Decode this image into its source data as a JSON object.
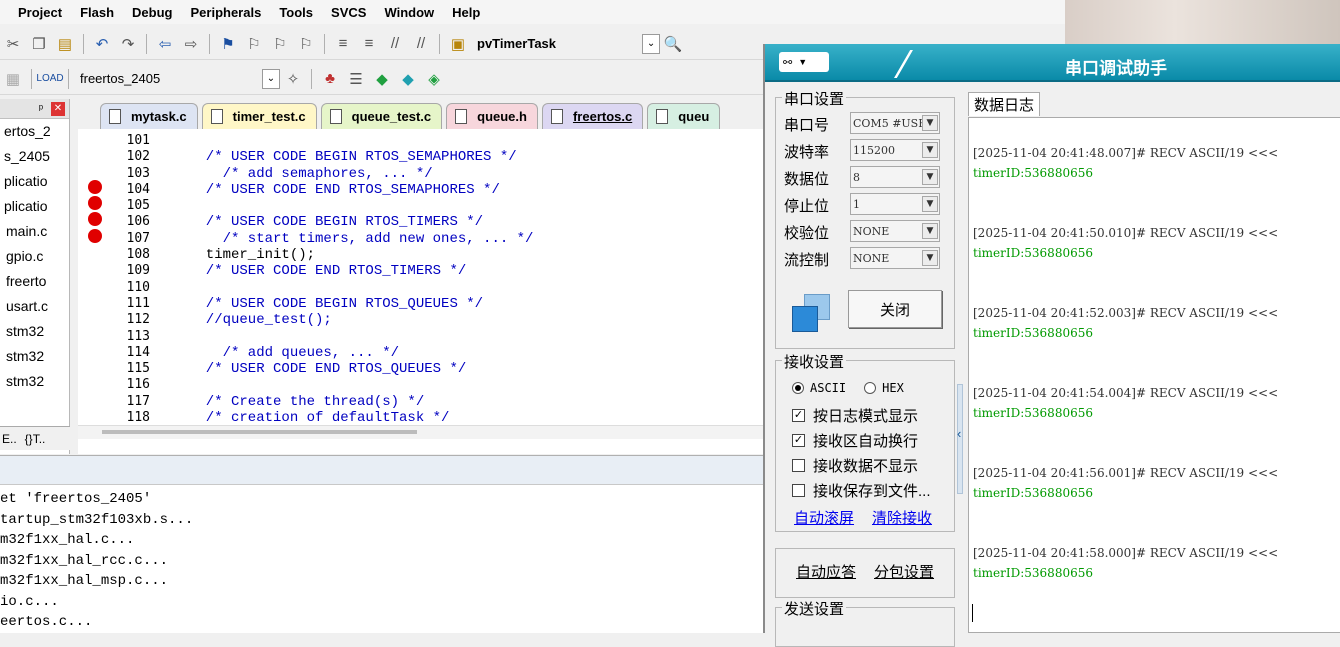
{
  "menubar": [
    "Project",
    "Flash",
    "Debug",
    "Peripherals",
    "Tools",
    "SVCS",
    "Window",
    "Help"
  ],
  "toolbar1": {
    "function_combo": "pvTimerTask"
  },
  "toolbar2": {
    "target_combo": "freertos_2405"
  },
  "project_tree": [
    "ertos_2",
    "s_2405",
    "plicatio",
    "plicatio",
    "main.c",
    "gpio.c",
    "freerto",
    "usart.c",
    "stm32",
    "stm32",
    "stm32"
  ],
  "project_tabs": [
    "E..",
    "{}T.."
  ],
  "editor_tabs": [
    {
      "label": "mytask.c",
      "color": "#dde4f3",
      "active": false
    },
    {
      "label": "timer_test.c",
      "color": "#fff7c7",
      "active": false
    },
    {
      "label": "queue_test.c",
      "color": "#e6f5c9",
      "active": false
    },
    {
      "label": "queue.h",
      "color": "#f7d6dc",
      "active": false
    },
    {
      "label": "freertos.c",
      "color": "#dcd7f2",
      "active": true
    },
    {
      "label": "queu",
      "color": "#d6efe2",
      "active": false
    }
  ],
  "code_lines": [
    {
      "n": "101",
      "t": "",
      "cls": "ck"
    },
    {
      "n": "102",
      "t": "  /* USER CODE BEGIN RTOS_SEMAPHORES */",
      "cls": "cm"
    },
    {
      "n": "103",
      "t": "    /* add semaphores, ... */",
      "cls": "cm"
    },
    {
      "n": "104",
      "t": "  /* USER CODE END RTOS_SEMAPHORES */",
      "cls": "cm"
    },
    {
      "n": "105",
      "t": "",
      "cls": "ck"
    },
    {
      "n": "106",
      "t": "  /* USER CODE BEGIN RTOS_TIMERS */",
      "cls": "cm"
    },
    {
      "n": "107",
      "t": "    /* start timers, add new ones, ... */",
      "cls": "cm"
    },
    {
      "n": "108",
      "t": "  timer_init();",
      "cls": "ck"
    },
    {
      "n": "109",
      "t": "  /* USER CODE END RTOS_TIMERS */",
      "cls": "cm"
    },
    {
      "n": "110",
      "t": "",
      "cls": "ck"
    },
    {
      "n": "111",
      "t": "  /* USER CODE BEGIN RTOS_QUEUES */",
      "cls": "cm"
    },
    {
      "n": "112",
      "t": "  //queue_test();",
      "cls": "cm"
    },
    {
      "n": "113",
      "t": "",
      "cls": "ck"
    },
    {
      "n": "114",
      "t": "    /* add queues, ... */",
      "cls": "cm"
    },
    {
      "n": "115",
      "t": "  /* USER CODE END RTOS_QUEUES */",
      "cls": "cm"
    },
    {
      "n": "116",
      "t": "",
      "cls": "ck"
    },
    {
      "n": "117",
      "t": "  /* Create the thread(s) */",
      "cls": "cm"
    },
    {
      "n": "118",
      "t": "  /* creation of defaultTask */",
      "cls": "cm"
    }
  ],
  "build_output": [
    "et 'freertos_2405'",
    "tartup_stm32f103xb.s...",
    "m32f1xx_hal.c...",
    "m32f1xx_hal_rcc.c...",
    "m32f1xx_hal_msp.c...",
    "io.c...",
    "eertos.c..."
  ],
  "serial": {
    "title": "串口调试助手",
    "port_group": "串口设置",
    "rows": [
      {
        "label": "串口号",
        "value": "COM5 #USE"
      },
      {
        "label": "波特率",
        "value": "115200"
      },
      {
        "label": "数据位",
        "value": "8"
      },
      {
        "label": "停止位",
        "value": "1"
      },
      {
        "label": "校验位",
        "value": "NONE"
      },
      {
        "label": "流控制",
        "value": "NONE"
      }
    ],
    "close_button": "关闭",
    "recv_group": "接收设置",
    "ascii": "ASCII",
    "hex": "HEX",
    "recv_checks": [
      {
        "label": "按日志模式显示",
        "checked": true
      },
      {
        "label": "接收区自动换行",
        "checked": true
      },
      {
        "label": "接收数据不显示",
        "checked": false
      },
      {
        "label": "接收保存到文件...",
        "checked": false
      }
    ],
    "auto_scroll": "自动滚屏",
    "clear_recv": "清除接收",
    "auto_reply": "自动应答",
    "packet_setting": "分包设置",
    "send_group": "发送设置",
    "log_tab": "数据日志",
    "log": [
      {
        "head": "[2025-11-04 20:41:48.007]# RECV ASCII/19 <<<",
        "body": "timerID:536880656"
      },
      {
        "head": "[2025-11-04 20:41:50.010]# RECV ASCII/19 <<<",
        "body": "timerID:536880656"
      },
      {
        "head": "[2025-11-04 20:41:52.003]# RECV ASCII/19 <<<",
        "body": "timerID:536880656"
      },
      {
        "head": "[2025-11-04 20:41:54.004]# RECV ASCII/19 <<<",
        "body": "timerID:536880656"
      },
      {
        "head": "[2025-11-04 20:41:56.001]# RECV ASCII/19 <<<",
        "body": "timerID:536880656"
      },
      {
        "head": "[2025-11-04 20:41:58.000]# RECV ASCII/19 <<<",
        "body": "timerID:536880656"
      }
    ]
  }
}
